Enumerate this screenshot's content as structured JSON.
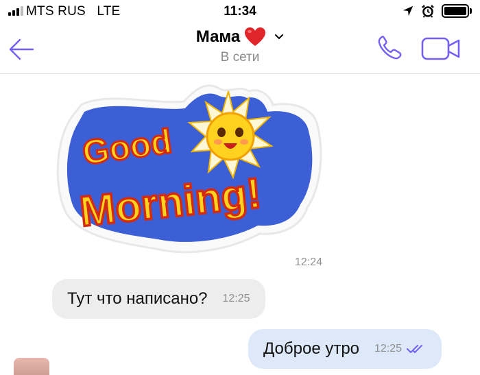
{
  "status_bar": {
    "carrier": "MTS RUS",
    "network": "LTE",
    "time": "11:34",
    "icons": [
      "signal-bars",
      "location-arrow",
      "alarm-clock",
      "battery-full"
    ]
  },
  "header": {
    "contact_name": "Мама",
    "contact_emoji": "❤️",
    "status": "В сети",
    "icons": [
      "back-arrow",
      "chevron-down",
      "phone",
      "video-camera"
    ],
    "accent_color": "#7360f2"
  },
  "messages": [
    {
      "type": "sticker",
      "direction": "incoming",
      "sticker_text": "Good Morning!",
      "time": "12:24"
    },
    {
      "type": "text",
      "direction": "incoming",
      "text": "Тут что написано?",
      "time": "12:25"
    },
    {
      "type": "text",
      "direction": "outgoing",
      "text": "Доброе утро",
      "time": "12:25",
      "status": "read"
    }
  ],
  "colors": {
    "incoming_bubble": "#ededee",
    "outgoing_bubble": "#dde9f8",
    "read_ticks": "#7360f2"
  }
}
